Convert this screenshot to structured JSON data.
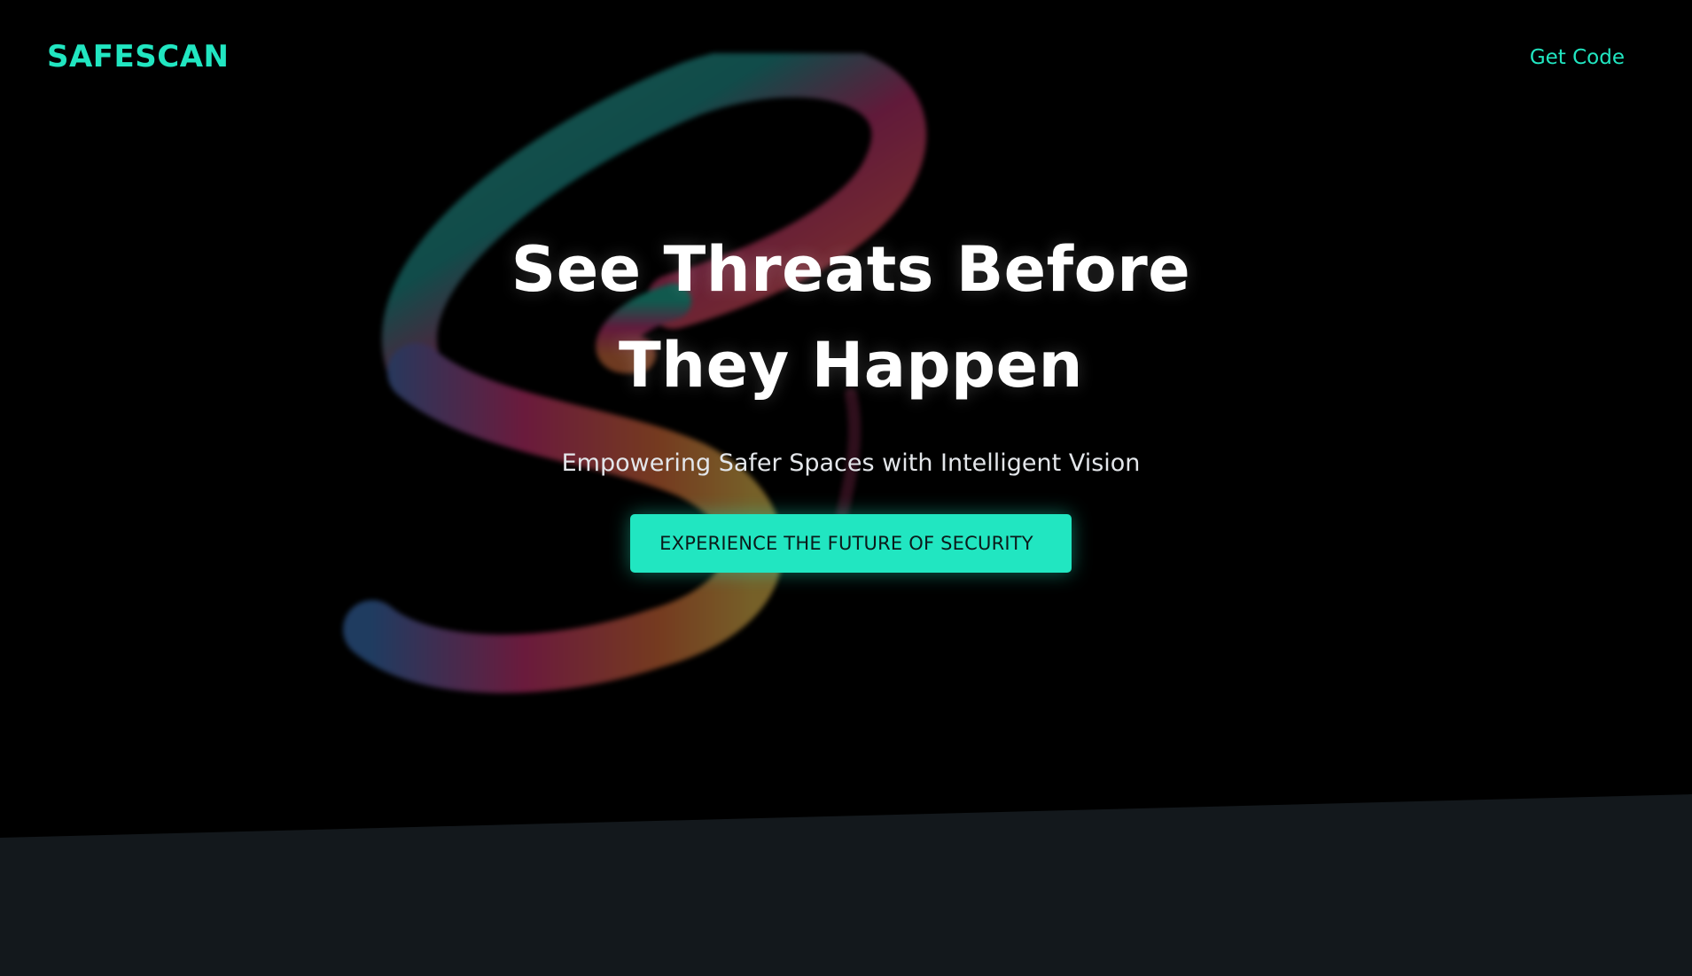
{
  "brand": {
    "name": "SAFESCAN",
    "accent_color": "#21e6c1"
  },
  "nav": {
    "get_code_label": "Get Code"
  },
  "hero": {
    "title": "See Threats Before They Happen",
    "subtitle": "Empowering Safer Spaces with Intelligent Vision",
    "cta_label": "EXPERIENCE THE FUTURE OF SECURITY",
    "background_art_icon": "swirl-s-artwork"
  },
  "colors": {
    "background": "#000000",
    "lower_section": "#13181c",
    "title_text": "#ffffff",
    "subtitle_text": "#e3e6ea",
    "cta_text": "#0b1a1a"
  }
}
